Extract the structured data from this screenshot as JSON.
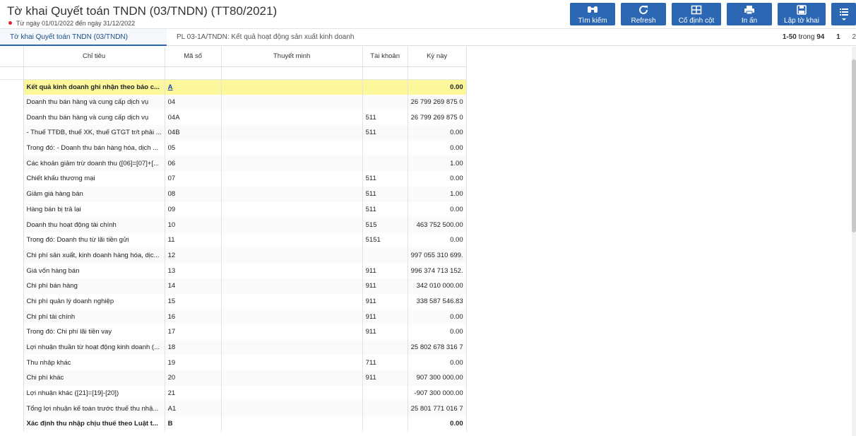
{
  "header": {
    "title": "Tờ khai Quyết toán TNDN (03/TNDN) (TT80/2021)",
    "subtitle": "Từ ngày 01/01/2022 đến ngày 31/12/2022"
  },
  "toolbar": {
    "search_label": "Tìm kiếm",
    "refresh_label": "Refresh",
    "freeze_label": "Cố định cột",
    "print_label": "In ấn",
    "create_label": "Lập tờ khai"
  },
  "tabs": [
    {
      "label": "Tờ khai Quyết toán TNDN (03/TNDN) (TT80/2021)"
    },
    {
      "label": "PL 03-1A/TNDN: Kết quả hoạt động sản xuất kinh doanh"
    }
  ],
  "pager": {
    "range": "1-50",
    "of_word": "trong",
    "total": "94",
    "page1": "1",
    "page2": "2"
  },
  "columns": [
    "Chỉ tiêu",
    "Mã số",
    "Thuyết minh",
    "Tài khoản",
    "Kỳ này"
  ],
  "colors": {
    "accent": "#2b67b3",
    "highlight": "#fbf79a"
  },
  "rows": [
    {
      "name": "Kết quả kinh doanh ghi nhận theo báo c...",
      "code": "A",
      "note": "",
      "account": "",
      "value": "0.00"
    },
    {
      "name": "Doanh thu bán hàng và cung cấp dịch vụ",
      "code": "04",
      "note": "",
      "account": "",
      "value": "26 799 269 875 0"
    },
    {
      "name": "Doanh thu bán hàng và cung cấp dịch vụ",
      "code": "04A",
      "note": "",
      "account": "511",
      "value": "26 799 269 875 0"
    },
    {
      "name": "- Thuế TTĐB, thuế XK, thuế GTGT tr/t phải ...",
      "code": "04B",
      "note": "",
      "account": "511",
      "value": "0.00"
    },
    {
      "name": "Trong đó: - Doanh thu bán hàng hóa, dịch ...",
      "code": "05",
      "note": "",
      "account": "",
      "value": "0.00"
    },
    {
      "name": "Các khoản giảm trừ doanh thu ([06]=[07]+[...",
      "code": "06",
      "note": "",
      "account": "",
      "value": "1.00"
    },
    {
      "name": "Chiết khấu thương mại",
      "code": "07",
      "note": "",
      "account": "511",
      "value": "0.00"
    },
    {
      "name": "Giảm giá hàng bán",
      "code": "08",
      "note": "",
      "account": "511",
      "value": "1.00"
    },
    {
      "name": "Hàng bán bị trả lại",
      "code": "09",
      "note": "",
      "account": "511",
      "value": "0.00"
    },
    {
      "name": "Doanh thu hoạt động tài chính",
      "code": "10",
      "note": "",
      "account": "515",
      "value": "463 752 500.00"
    },
    {
      "name": "Trong đó: Doanh thu từ lãi tiền gửi",
      "code": "11",
      "note": "",
      "account": "5151",
      "value": "0.00"
    },
    {
      "name": "Chi phí sản xuất, kinh doanh hàng hóa, dịc...",
      "code": "12",
      "note": "",
      "account": "",
      "value": "997 055 310 699."
    },
    {
      "name": "Giá vốn hàng bán",
      "code": "13",
      "note": "",
      "account": "911",
      "value": "996 374 713 152."
    },
    {
      "name": "Chi phí bán hàng",
      "code": "14",
      "note": "",
      "account": "911",
      "value": "342 010 000.00"
    },
    {
      "name": "Chi phí quản lý doanh nghiệp",
      "code": "15",
      "note": "",
      "account": "911",
      "value": "338 587 546.83"
    },
    {
      "name": "Chi phí tài chính",
      "code": "16",
      "note": "",
      "account": "911",
      "value": "0.00"
    },
    {
      "name": "Trong đó: Chi phí lãi tiền vay",
      "code": "17",
      "note": "",
      "account": "911",
      "value": "0.00"
    },
    {
      "name": "Lợi nhuận thuần từ hoạt động kinh doanh (...",
      "code": "18",
      "note": "",
      "account": "",
      "value": "25 802 678 316 7"
    },
    {
      "name": "Thu nhập khác",
      "code": "19",
      "note": "",
      "account": "711",
      "value": "0.00"
    },
    {
      "name": "Chi phí khác",
      "code": "20",
      "note": "",
      "account": "911",
      "value": "907 300 000.00"
    },
    {
      "name": "Lợi nhuận khác ([21]=[19]-[20])",
      "code": "21",
      "note": "",
      "account": "",
      "value": "-907 300 000.00"
    },
    {
      "name": "Tổng lợi nhuận kế toán trước thuế thu nhậ...",
      "code": "A1",
      "note": "",
      "account": "",
      "value": "25 801 771 016 7"
    },
    {
      "name": "Xác định thu nhập chịu thuế theo Luật t...",
      "code": "B",
      "note": "",
      "account": "",
      "value": "0.00"
    }
  ]
}
